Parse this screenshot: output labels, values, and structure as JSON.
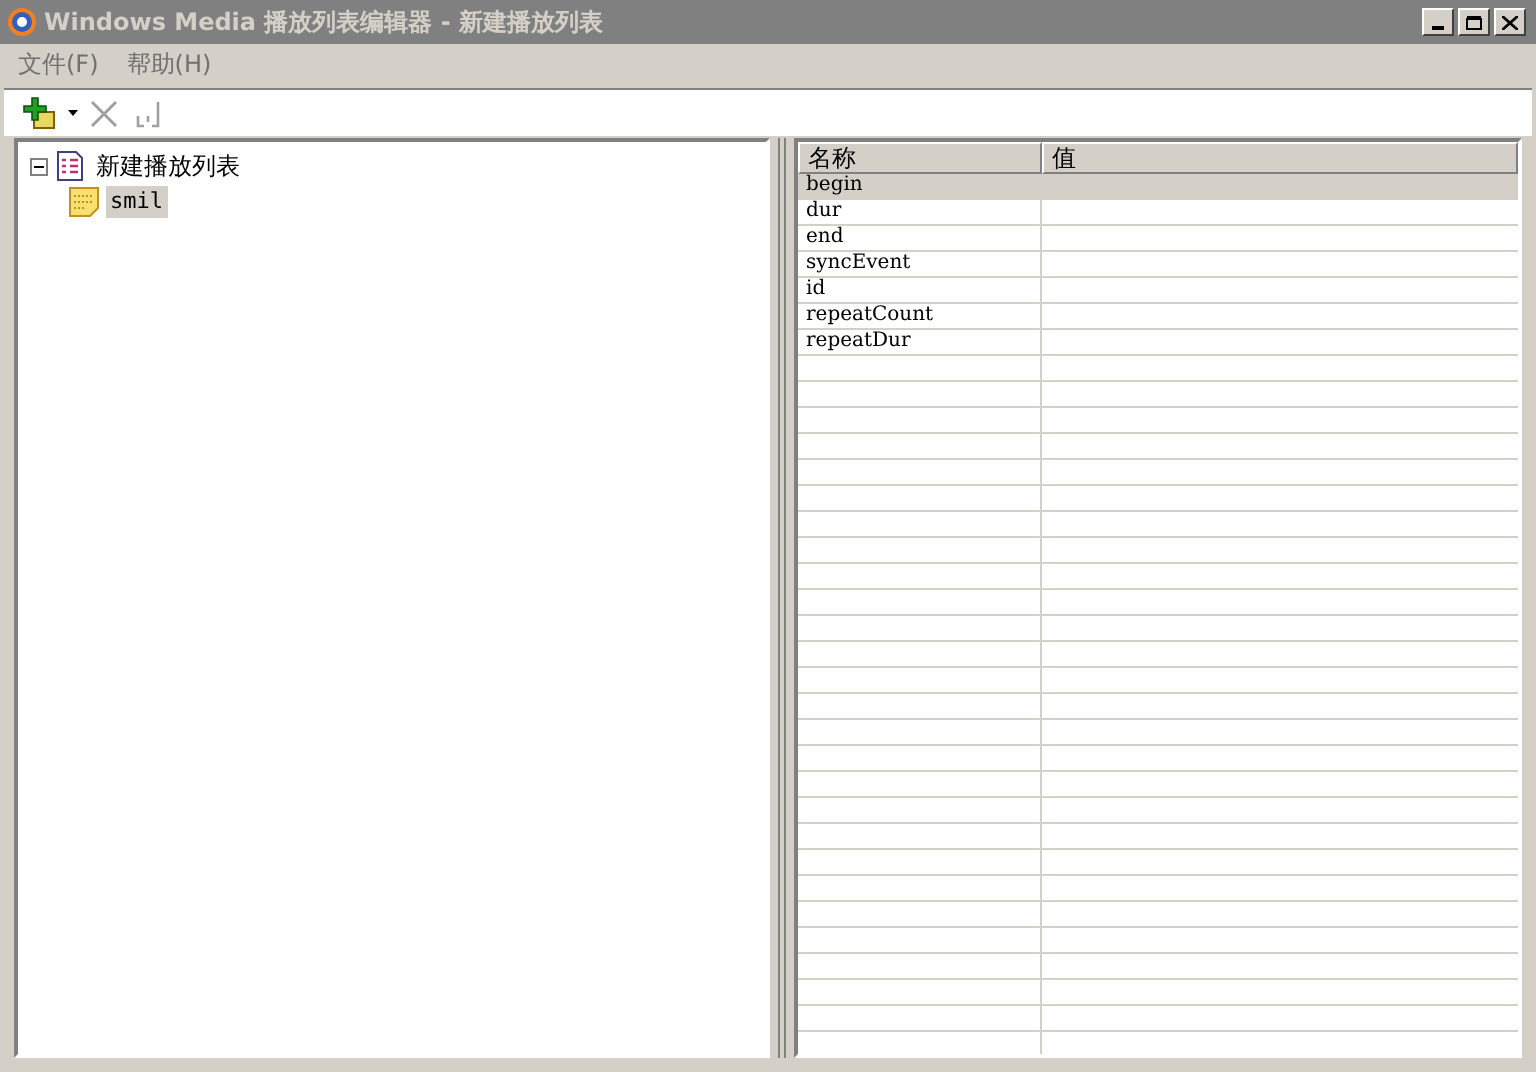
{
  "window": {
    "title": "Windows Media 播放列表编辑器 - 新建播放列表",
    "active": false
  },
  "menu": [
    {
      "label": "文件(F)"
    },
    {
      "label": "帮助(H)"
    }
  ],
  "toolbar": [
    {
      "kind": "add",
      "disabled": false
    },
    {
      "kind": "dropdown",
      "disabled": false
    },
    {
      "kind": "delete",
      "disabled": true
    },
    {
      "kind": "properties",
      "disabled": true
    }
  ],
  "tree": [
    {
      "label": "新建播放列表",
      "kind": "playlist",
      "expanded": true,
      "selected": false,
      "children": [
        {
          "label": "smil",
          "kind": "element",
          "selected": true
        }
      ]
    }
  ],
  "table": {
    "columns": [
      "名称",
      "值"
    ],
    "rows": [
      {
        "name": "begin",
        "value": "",
        "selected": true
      },
      {
        "name": "dur",
        "value": "",
        "selected": false
      },
      {
        "name": "end",
        "value": "",
        "selected": false
      },
      {
        "name": "syncEvent",
        "value": "",
        "selected": false
      },
      {
        "name": "id",
        "value": "",
        "selected": false
      },
      {
        "name": "repeatCount",
        "value": "",
        "selected": false
      },
      {
        "name": "repeatDur",
        "value": "",
        "selected": false
      }
    ]
  }
}
